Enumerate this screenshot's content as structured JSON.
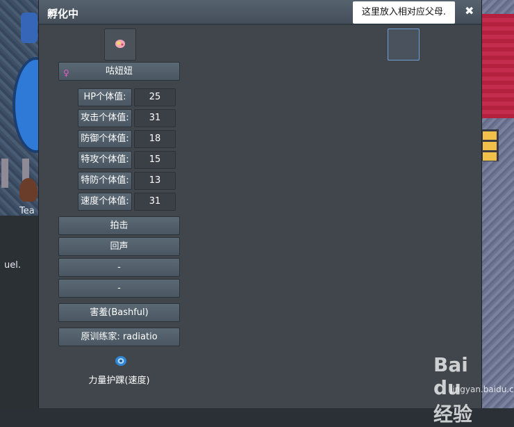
{
  "window": {
    "title": "孵化中",
    "close_glyph": "✖",
    "tooltip": "这里放入相对应父母."
  },
  "pokemon": {
    "name": "咕妞妞",
    "gender_icon": "female-icon",
    "gender_glyph": "♀"
  },
  "stats": [
    {
      "label": "HP个体值:",
      "value": "25"
    },
    {
      "label": "攻击个体值:",
      "value": "31"
    },
    {
      "label": "防御个体值:",
      "value": "18"
    },
    {
      "label": "特攻个体值:",
      "value": "15"
    },
    {
      "label": "特防个体值:",
      "value": "13"
    },
    {
      "label": "速度个体值:",
      "value": "31"
    }
  ],
  "moves": [
    "拍击",
    "回声",
    "-",
    "-"
  ],
  "nature": "害羞(Bashful)",
  "trainer": "原训练家: radiatio",
  "held_item": {
    "name": "力量护踝(速度)",
    "icon": "power-anklet-icon"
  },
  "background_text": {
    "name_fragment": "Tea",
    "chat_fragment": "uel."
  },
  "watermark": {
    "logo": "Bai du 经验",
    "url": "jingyan.baidu.com"
  },
  "colors": {
    "panel": "#40464b",
    "button": "#4f5c67",
    "accent": "#6ea0d8",
    "female": "#e35cc0"
  }
}
